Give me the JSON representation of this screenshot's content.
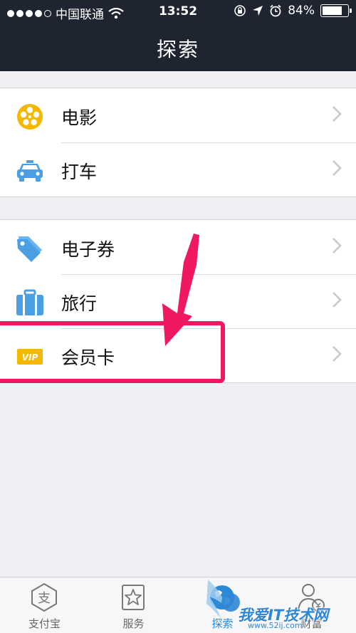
{
  "status_bar": {
    "carrier": "中国联通",
    "time": "13:52",
    "battery_text": "84%",
    "battery_level": 0.84
  },
  "nav": {
    "title": "探索"
  },
  "groups": [
    {
      "rows": [
        {
          "label": "电影",
          "icon": "film-reel-icon"
        },
        {
          "label": "打车",
          "icon": "taxi-icon"
        }
      ]
    },
    {
      "rows": [
        {
          "label": "电子券",
          "icon": "coupon-tag-icon"
        },
        {
          "label": "旅行",
          "icon": "suitcase-icon"
        },
        {
          "label": "会员卡",
          "icon": "vip-card-icon",
          "vip_text": "VIP"
        }
      ]
    }
  ],
  "tabs": [
    {
      "label": "支付宝",
      "icon": "alipay-icon"
    },
    {
      "label": "服务",
      "icon": "star-icon"
    },
    {
      "label": "探索",
      "icon": "globe-icon",
      "active": true
    },
    {
      "label": "财富",
      "icon": "person-wealth-icon"
    }
  ],
  "watermark": {
    "text": "我爱IT技术网",
    "url": "www.52ij.com"
  },
  "colors": {
    "bar_background": "#1f2530",
    "highlight": "#f0195f",
    "film_icon": "#f5b800",
    "blue_icon": "#4a9fe4",
    "active_tab": "#2a8ad8"
  }
}
